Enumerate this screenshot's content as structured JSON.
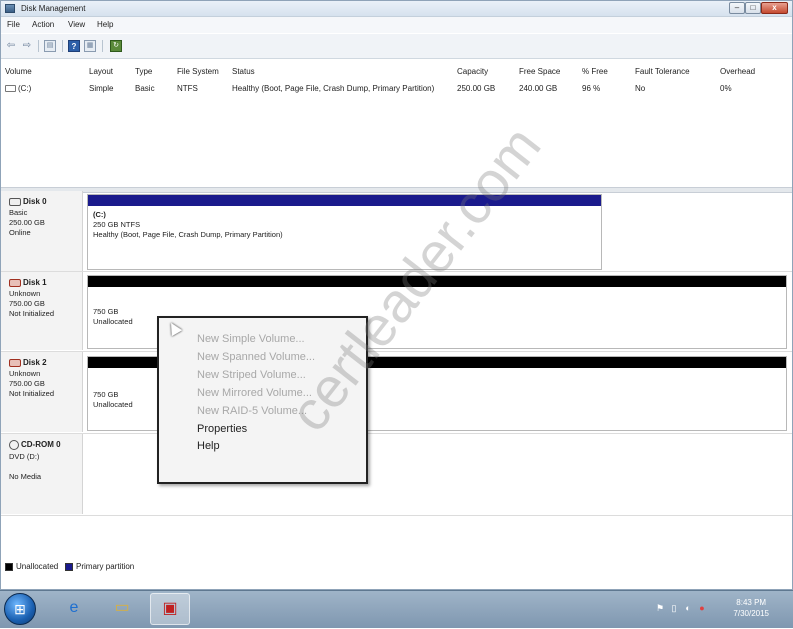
{
  "window": {
    "title": "Disk Management"
  },
  "menu": [
    "File",
    "Action",
    "View",
    "Help"
  ],
  "toolbar": {
    "icons": [
      "back-arrow-icon",
      "forward-arrow-icon",
      "console-tree-icon",
      "help-icon",
      "properties-icon",
      "refresh-icon"
    ]
  },
  "columns": [
    "Volume",
    "Layout",
    "Type",
    "File System",
    "Status",
    "Capacity",
    "Free Space",
    "% Free",
    "Fault Tolerance",
    "Overhead"
  ],
  "volumes": [
    {
      "volume": "(C:)",
      "layout": "Simple",
      "type": "Basic",
      "fs": "NTFS",
      "status": "Healthy (Boot, Page File, Crash Dump, Primary Partition)",
      "capacity": "250.00 GB",
      "free": "240.00 GB",
      "pct": "96 %",
      "fault": "No",
      "overhead": "0%"
    }
  ],
  "disks": [
    {
      "name": "Disk 0",
      "type": "Basic",
      "size": "250.00 GB",
      "state": "Online",
      "vol_title": "(C:)",
      "vol_size": "250 GB NTFS",
      "vol_status": "Healthy (Boot, Page File, Crash Dump, Primary Partition)"
    },
    {
      "name": "Disk 1",
      "type": "Unknown",
      "size": "750.00 GB",
      "state": "Not Initialized",
      "vol_size": "750 GB",
      "vol_status": "Unallocated"
    },
    {
      "name": "Disk 2",
      "type": "Unknown",
      "size": "750.00 GB",
      "state": "Not Initialized",
      "vol_size": "750 GB",
      "vol_status": "Unallocated"
    },
    {
      "name": "CD-ROM 0",
      "type": "DVD (D:)",
      "state": "No Media"
    }
  ],
  "context_menu": {
    "items": [
      {
        "label": "New Simple Volume...",
        "enabled": false
      },
      {
        "label": "New Spanned Volume...",
        "enabled": false
      },
      {
        "label": "New Striped Volume...",
        "enabled": false
      },
      {
        "label": "New Mirrored Volume...",
        "enabled": false
      },
      {
        "label": "New RAID-5 Volume...",
        "enabled": false
      },
      {
        "label": "Properties",
        "enabled": true
      },
      {
        "label": "Help",
        "enabled": true
      }
    ]
  },
  "legend": [
    {
      "label": "Unallocated",
      "color": "#000000"
    },
    {
      "label": "Primary partition",
      "color": "#1a1a8c"
    }
  ],
  "watermark": "certleader.com",
  "taskbar": {
    "items": [
      "start-orb",
      "internet-explorer-icon",
      "file-explorer-icon",
      "toolbox-icon"
    ],
    "time": "8:43 PM",
    "date": "7/30/2015"
  },
  "colors": {
    "primary_bar": "#1a1a8c",
    "unallocated_bar": "#000000"
  }
}
